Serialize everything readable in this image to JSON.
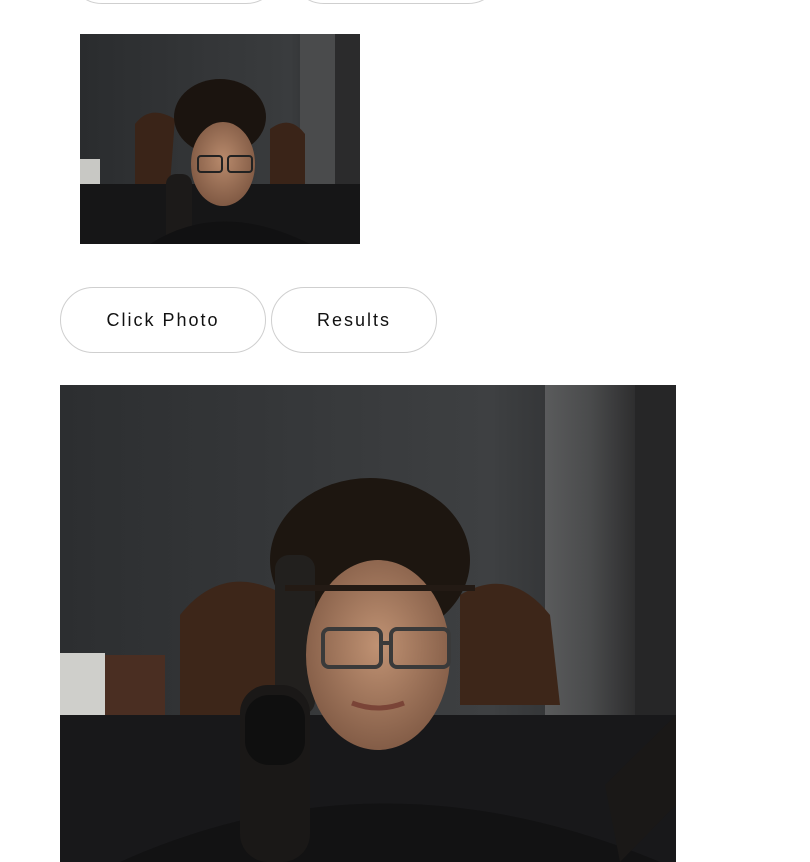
{
  "buttons": {
    "click_photo_label": "Click Photo",
    "results_label": "Results"
  },
  "colors": {
    "button_border": "#cfcfcf",
    "button_text": "#111111",
    "background": "#ffffff"
  }
}
